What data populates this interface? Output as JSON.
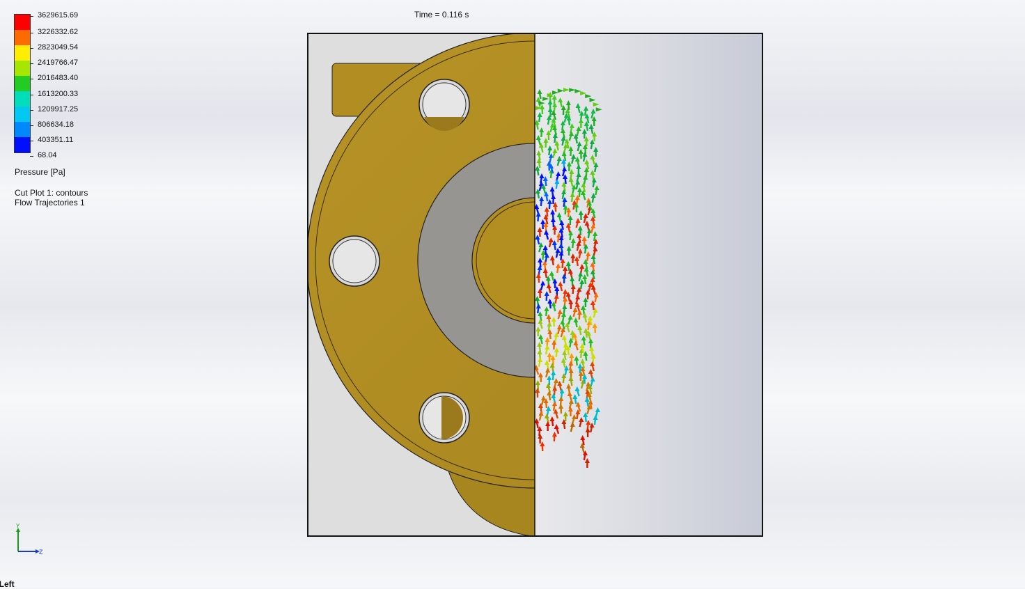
{
  "title": "Time = 0.116 s",
  "legend": {
    "quantity": "Pressure [Pa]",
    "values": [
      "3629615.69",
      "3226332.62",
      "2823049.54",
      "2419766.47",
      "2016483.40",
      "1613200.33",
      "1209917.25",
      "806634.18",
      "403351.11",
      "68.04"
    ],
    "colors": [
      "#ff0000",
      "#ff6a00",
      "#ffee00",
      "#a6e600",
      "#22cc22",
      "#00ddbb",
      "#00c8f0",
      "#0088ff",
      "#0010ff"
    ]
  },
  "plots": {
    "cut_plot": "Cut Plot 1: contours",
    "flow_trajectories": "Flow Trajectories 1"
  },
  "view": {
    "name": "*Left",
    "triad_y": "Y",
    "triad_z": "Z"
  },
  "colors": {
    "flange": "#b08c22",
    "bore_gray": "#979592",
    "panel_left": "#dedede"
  }
}
